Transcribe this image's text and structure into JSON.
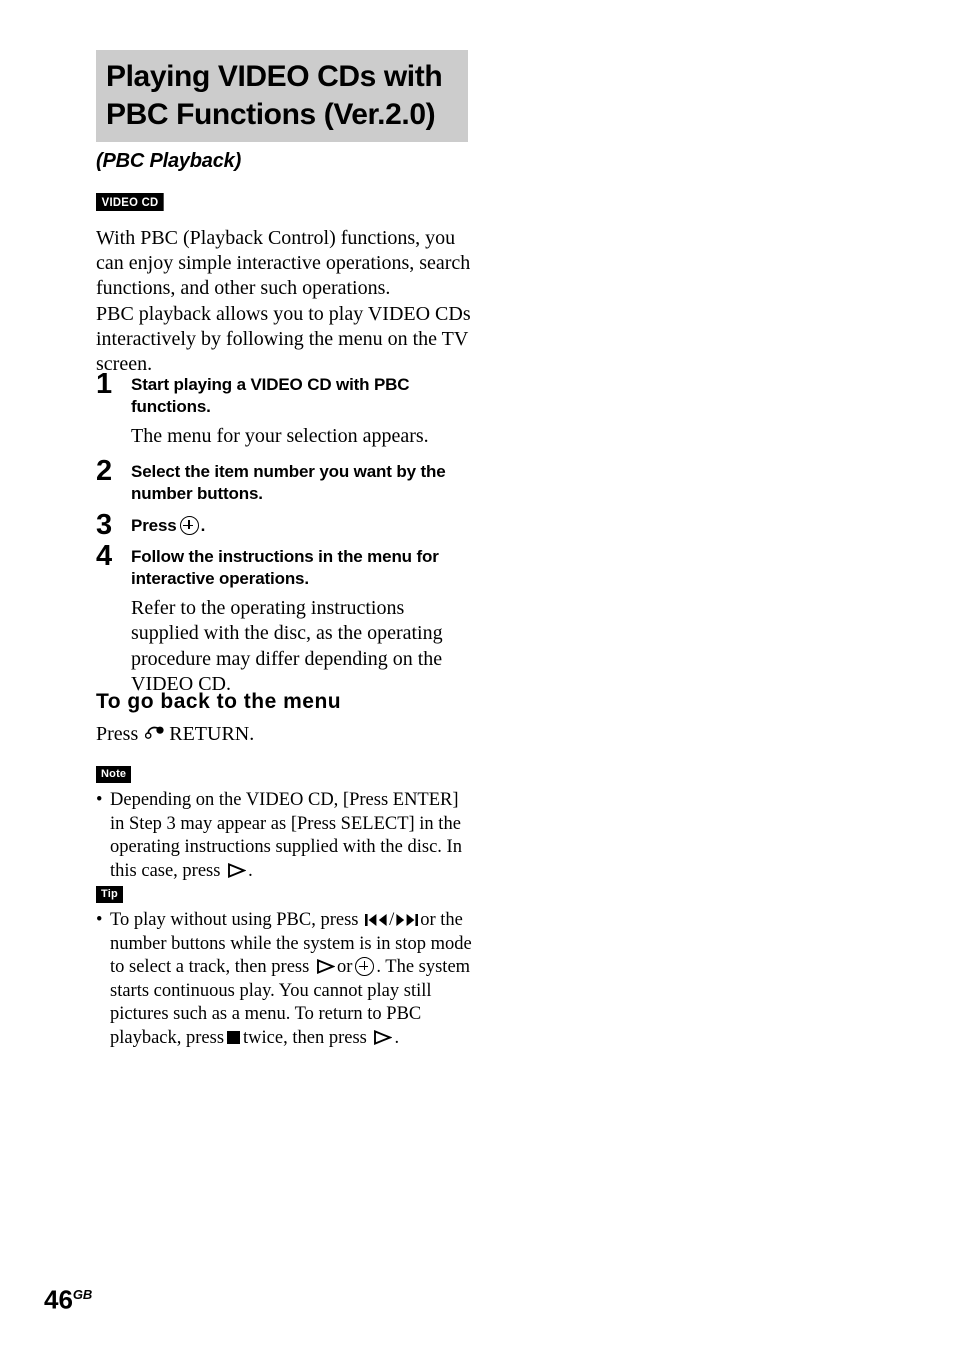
{
  "page": {
    "number": "46",
    "region_code": "GB"
  },
  "header": {
    "title": "Playing VIDEO CDs with\nPBC Functions (Ver.2.0)",
    "title_line1": "Playing VIDEO CDs with",
    "title_line2": "PBC Functions (Ver.2.0)",
    "subtitle": "(PBC Playback)",
    "title_band_color": "#cccccc"
  },
  "disc_badge": {
    "label": "VIDEO CD",
    "background": "#000000",
    "text_color": "#ffffff"
  },
  "intro": {
    "text": "With PBC (Playback Control) functions, you can enjoy simple interactive operations, search functions, and other such operations.\nPBC playback allows you to play VIDEO CDs interactively by following the menu on the TV screen."
  },
  "steps": [
    {
      "number": "1",
      "heading": "Start playing a VIDEO CD with PBC functions.",
      "body": "The menu for your selection appears."
    },
    {
      "number": "2",
      "heading": "Select the item number you want by the number buttons.",
      "body": ""
    },
    {
      "number": "3",
      "heading_before": "Press",
      "heading_after": ".",
      "icon": "enter-circle-plus-icon",
      "body": ""
    },
    {
      "number": "4",
      "heading": "Follow the instructions in the menu for interactive operations.",
      "body": "Refer to the operating instructions supplied with the disc, as the operating procedure may differ depending on the VIDEO CD."
    }
  ],
  "section": {
    "heading": "To go back to the menu",
    "body_before": "Press",
    "body_after": "RETURN.",
    "icon": "return-arrow-icon"
  },
  "note": {
    "badge": "Note",
    "bullet": "•",
    "text_part1": "Depending on the VIDEO CD, [Press ENTER] in Step 3 may appear as [Press SELECT] in the operating instructions supplied with the disc. In this case, press",
    "text_part2": ".",
    "icon": "play-triangle-icon"
  },
  "tip": {
    "badge": "Tip",
    "bullet": "•",
    "text_part1": "To play without using PBC, press",
    "separator": "/",
    "text_part2": "or the number buttons while the system is in stop mode to select a track, then press",
    "text_part3": "or",
    "text_part4": ". The system starts continuous play. You cannot play still pictures such as a menu. To return to PBC playback, press",
    "text_part5": "twice, then press",
    "text_part6": ".",
    "icons": [
      "prev-track-icon",
      "next-track-icon",
      "play-triangle-icon",
      "enter-circle-plus-icon",
      "stop-square-icon",
      "play-triangle-icon"
    ]
  }
}
